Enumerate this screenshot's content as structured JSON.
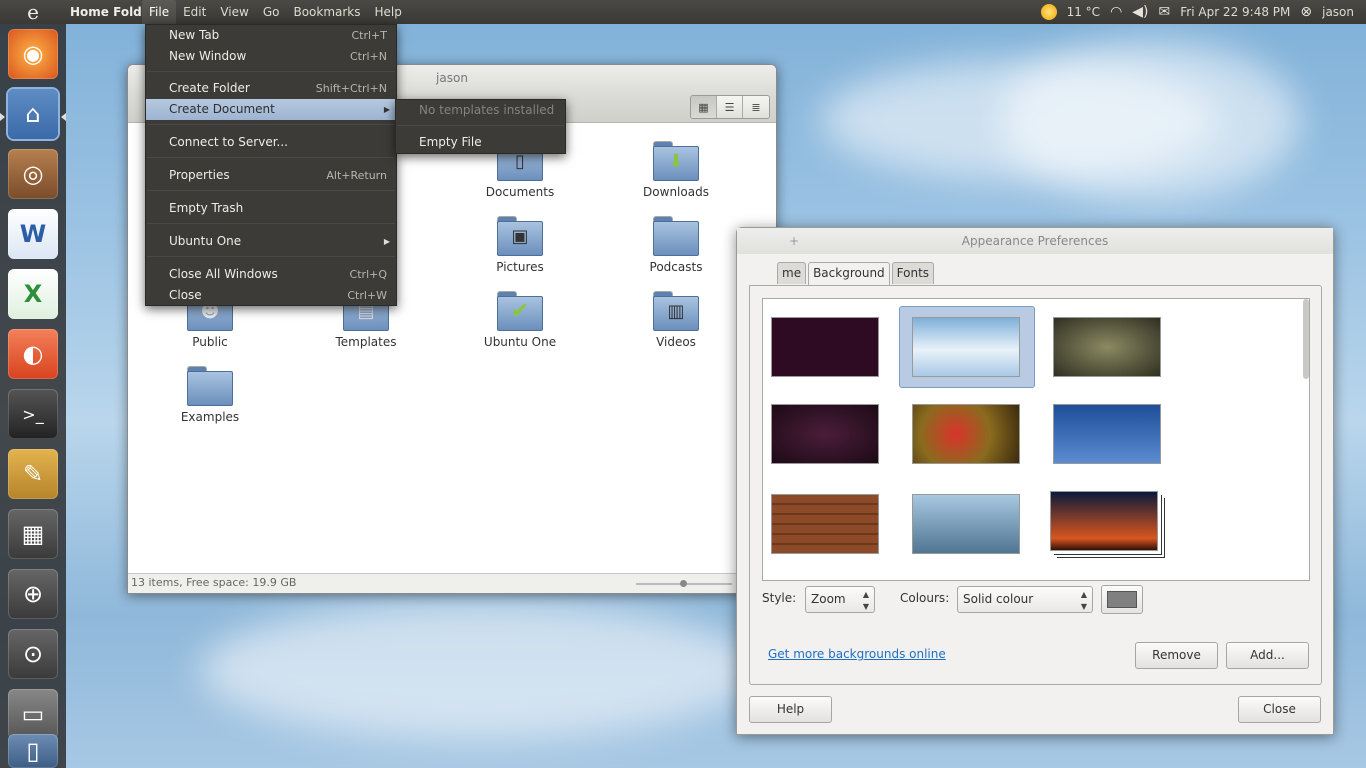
{
  "top_panel": {
    "app_name": "Home Fold",
    "menu": [
      "File",
      "Edit",
      "View",
      "Go",
      "Bookmarks",
      "Help"
    ],
    "weather": "11 °C",
    "datetime": "Fri Apr 22  9:48 PM",
    "user": "jason"
  },
  "file_manager": {
    "title": "jason",
    "status": "13 items, Free space: 19.9 GB",
    "items": [
      {
        "label": "Documents",
        "emblem": "document-icon"
      },
      {
        "label": "Downloads",
        "emblem": "download-arrow-icon"
      },
      {
        "label": "Pictures",
        "emblem": "photo-icon"
      },
      {
        "label": "Podcasts",
        "emblem": ""
      },
      {
        "label": "Public",
        "emblem": "person-icon"
      },
      {
        "label": "Templates",
        "emblem": "template-icon"
      },
      {
        "label": "Ubuntu One",
        "emblem": "checkmark-icon"
      },
      {
        "label": "Videos",
        "emblem": "film-icon"
      },
      {
        "label": "Examples",
        "emblem": ""
      }
    ]
  },
  "file_menu": {
    "items": [
      {
        "label": "New Tab",
        "accel": "Ctrl+T"
      },
      {
        "label": "New Window",
        "accel": "Ctrl+N"
      },
      {
        "label": "Create Folder",
        "accel": "Shift+Ctrl+N"
      },
      {
        "label": "Create Document",
        "accel": ""
      },
      {
        "label": "Connect to Server...",
        "accel": ""
      },
      {
        "label": "Properties",
        "accel": "Alt+Return"
      },
      {
        "label": "Empty Trash",
        "accel": ""
      },
      {
        "label": "Ubuntu One",
        "accel": ""
      },
      {
        "label": "Close All Windows",
        "accel": "Ctrl+Q"
      },
      {
        "label": "Close",
        "accel": "Ctrl+W"
      }
    ],
    "submenu": {
      "no_templates": "No templates installed",
      "empty_file": "Empty File"
    }
  },
  "appearance": {
    "title": "Appearance Preferences",
    "tabs": [
      "me",
      "Background",
      "Fonts"
    ],
    "style_label": "Style:",
    "style_value": "Zoom",
    "colours_label": "Colours:",
    "colours_value": "Solid colour",
    "swatch_color": "#808080",
    "more_link": "Get more backgrounds online",
    "remove_label": "Remove",
    "add_label": "Add...",
    "help_label": "Help",
    "close_label": "Close"
  },
  "colors": {
    "panel_bg": "#3c3b37",
    "menu_highlight": "#b6c9e0",
    "folder_blue": "#6b8fbc",
    "link_blue": "#1f6fc4"
  }
}
